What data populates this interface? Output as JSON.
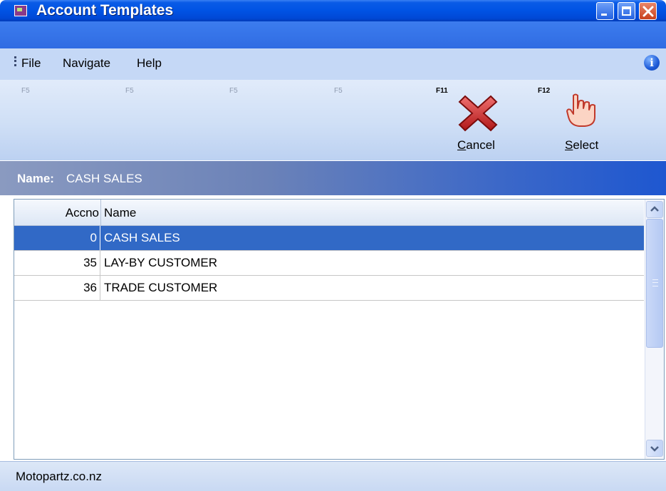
{
  "window": {
    "title": "Account Templates",
    "controls": [
      "minimize",
      "maximize",
      "close"
    ]
  },
  "menu": {
    "items": [
      "File",
      "Navigate",
      "Help"
    ],
    "info_icon": "info-icon"
  },
  "toolbar": {
    "fkeys": [
      "F5",
      "F5",
      "F5",
      "F5"
    ],
    "cancel": {
      "key": "F11",
      "label": "Cancel",
      "icon": "cancel-x-icon"
    },
    "select": {
      "key": "F12",
      "label": "Select",
      "icon": "pointing-hand-icon"
    }
  },
  "namebar": {
    "label": "Name:",
    "value": "CASH SALES"
  },
  "table": {
    "columns": [
      "Accno",
      "Name"
    ],
    "rows": [
      {
        "accno": "0",
        "name": "CASH SALES",
        "selected": true
      },
      {
        "accno": "35",
        "name": "LAY-BY CUSTOMER",
        "selected": false
      },
      {
        "accno": "36",
        "name": "TRADE CUSTOMER",
        "selected": false
      }
    ]
  },
  "status": {
    "text": "Motopartz.co.nz"
  },
  "colors": {
    "title_bar": "#0053e4",
    "selection": "#3169c6",
    "close_button": "#c8401c"
  }
}
